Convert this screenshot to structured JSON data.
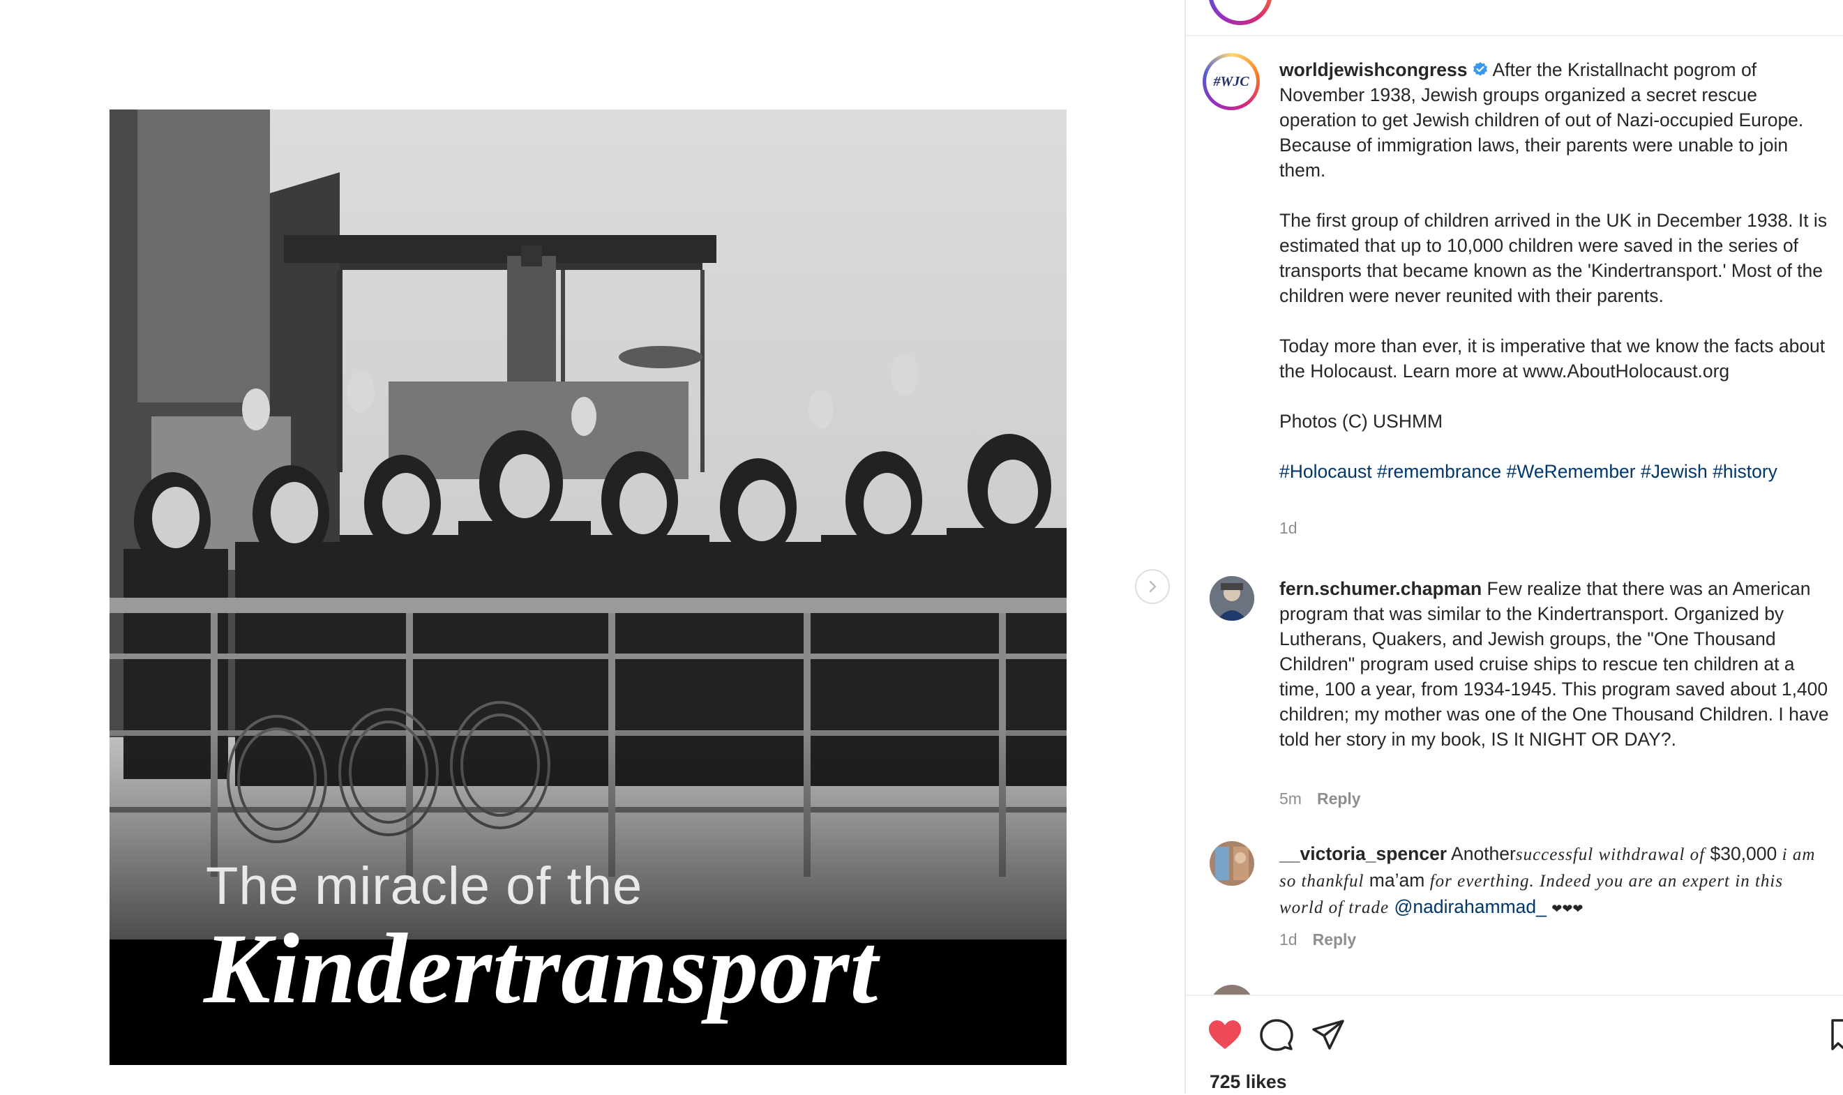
{
  "post": {
    "overlay_line1": "The miracle of the",
    "overlay_line2": "Kindertransport"
  },
  "caption": {
    "username": "worldjewishcongress",
    "avatar_text": "#WJC",
    "paragraph1": "After the Kristallnacht pogrom of November 1938, Jewish groups organized a secret rescue operation to get Jewish children of out of Nazi-occupied Europe. Because of immigration laws, their parents were unable to join them.",
    "paragraph2": "The first group of children arrived in the UK in December 1938. It is estimated that up to 10,000 children were saved in the series of transports that became known as the 'Kindertransport.' Most of the children were never reunited with their parents.",
    "paragraph3": "Today more than ever, it is imperative that we know the facts about the Holocaust. Learn more at www.AboutHolocaust.org",
    "paragraph4": "Photos (C) USHMM",
    "hashtags": [
      "#Holocaust",
      "#remembrance",
      "#WeRemember",
      "#Jewish",
      "#history"
    ],
    "time": "1d"
  },
  "comments": [
    {
      "username": "fern.schumer.chapman",
      "text": "Few realize that there was an American program that was similar to the Kindertransport. Organized by Lutherans, Quakers, and Jewish groups, the \"One Thousand Children\" program used cruise ships to rescue ten children at a time, 100 a year, from 1934-1945. This program saved about 1,400 children; my mother was one of the One Thousand Children. I have told her story in my book, IS It NIGHT OR DAY?.",
      "time": "5m",
      "reply_label": "Reply"
    },
    {
      "username": "__victoria_spencer",
      "text_parts": [
        "Another",
        "successful withdrawal of",
        "$30,000",
        "i am so thankful",
        "ma’am",
        "for everthing. Indeed you are an expert in this world of trade",
        "@nadirahammad_",
        "❤❤❤"
      ],
      "time": "1d",
      "reply_label": "Reply"
    }
  ],
  "actions": {
    "like_icon": "heart-filled-icon",
    "comment_icon": "comment-icon",
    "share_icon": "paper-plane-icon",
    "save_icon": "bookmark-icon",
    "like_color": "#ed4956"
  },
  "likes": "725 likes",
  "colors": {
    "link": "#00376b",
    "muted": "#8e8e8e",
    "text": "#262626"
  }
}
